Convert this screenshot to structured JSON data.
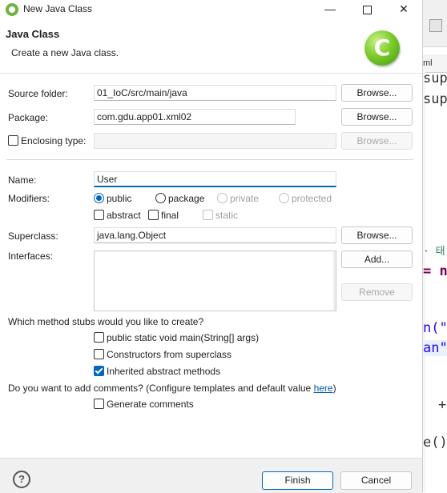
{
  "window": {
    "title": "New Java Class"
  },
  "header": {
    "title": "Java Class",
    "description": "Create a new Java class.",
    "graphic_icon": "new-class-wizard-icon",
    "graphic_letter": "C"
  },
  "fields": {
    "source_folder": {
      "label": "Source folder:",
      "value": "01_IoC/src/main/java",
      "button": "Browse..."
    },
    "package": {
      "label": "Package:",
      "value": "com.gdu.app01.xml02",
      "button": "Browse..."
    },
    "enclosing_type": {
      "label": "Enclosing type:",
      "value": "",
      "checked": false,
      "button": "Browse..."
    },
    "name": {
      "label": "Name:",
      "value": "User"
    },
    "modifiers": {
      "label": "Modifiers:",
      "access": [
        {
          "label": "public",
          "checked": true
        },
        {
          "label": "package",
          "checked": false
        },
        {
          "label": "private",
          "checked": false,
          "disabled": true
        },
        {
          "label": "protected",
          "checked": false,
          "disabled": true
        }
      ],
      "flags": [
        {
          "label": "abstract",
          "checked": false
        },
        {
          "label": "final",
          "checked": false
        },
        {
          "label": "static",
          "checked": false,
          "disabled": true
        }
      ]
    },
    "superclass": {
      "label": "Superclass:",
      "value": "java.lang.Object",
      "button": "Browse..."
    },
    "interfaces": {
      "label": "Interfaces:",
      "add_button": "Add...",
      "remove_button": "Remove"
    }
  },
  "stubs": {
    "question": "Which method stubs would you like to create?",
    "options": [
      {
        "label": "public static void main(String[] args)",
        "checked": false
      },
      {
        "label": "Constructors from superclass",
        "checked": false
      },
      {
        "label": "Inherited abstract methods",
        "checked": true
      }
    ]
  },
  "comments": {
    "question_prefix": "Do you want to add comments? (Configure templates and default value ",
    "link": "here",
    "question_suffix": ")",
    "option": {
      "label": "Generate comments",
      "checked": false
    }
  },
  "footer": {
    "finish": "Finish",
    "cancel": "Cancel"
  },
  "background_editor": {
    "tab": "ml",
    "lines": [
      "sup",
      "sup",
      "· 태",
      "= ne",
      "n(\"",
      "an\"",
      "+",
      "e()"
    ]
  },
  "colors": {
    "accent": "#0067c0",
    "spring_green": "#6db33f",
    "link": "#0057b8"
  }
}
